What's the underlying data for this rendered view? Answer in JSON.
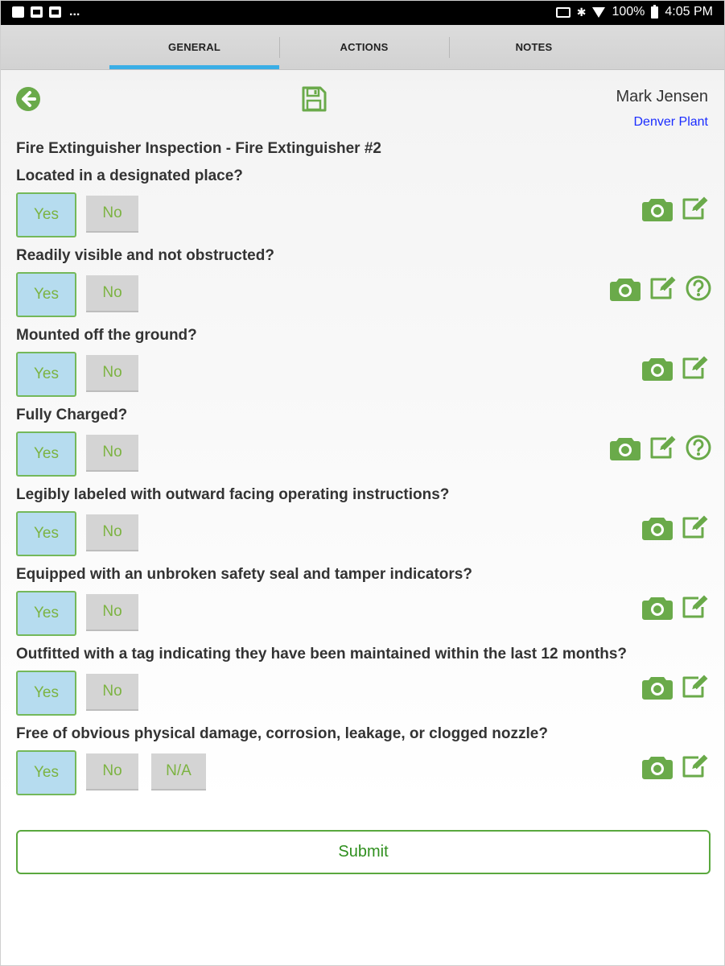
{
  "status_bar": {
    "dots": "...",
    "battery": "100%",
    "time": "4:05 PM"
  },
  "tabs": [
    {
      "label": "GENERAL",
      "active": true
    },
    {
      "label": "ACTIONS",
      "active": false
    },
    {
      "label": "NOTES",
      "active": false
    }
  ],
  "header": {
    "user_name": "Mark Jensen",
    "location": "Denver Plant"
  },
  "form_title": "Fire Extinguisher Inspection - Fire Extinguisher #2",
  "questions": [
    {
      "text": "Located in a designated place?",
      "options": [
        "Yes",
        "No"
      ],
      "selected": "Yes",
      "icons": [
        "camera-icon",
        "edit-icon"
      ]
    },
    {
      "text": "Readily visible and not obstructed?",
      "options": [
        "Yes",
        "No"
      ],
      "selected": "Yes",
      "icons": [
        "camera-icon",
        "edit-icon",
        "help-icon"
      ]
    },
    {
      "text": "Mounted off the ground?",
      "options": [
        "Yes",
        "No"
      ],
      "selected": "Yes",
      "icons": [
        "camera-icon",
        "edit-icon"
      ]
    },
    {
      "text": "Fully Charged?",
      "options": [
        "Yes",
        "No"
      ],
      "selected": "Yes",
      "icons": [
        "camera-icon",
        "edit-icon",
        "help-icon"
      ]
    },
    {
      "text": "Legibly labeled with outward facing operating instructions?",
      "options": [
        "Yes",
        "No"
      ],
      "selected": "Yes",
      "icons": [
        "camera-icon",
        "edit-icon"
      ]
    },
    {
      "text": "Equipped with an unbroken safety seal and tamper indicators?",
      "options": [
        "Yes",
        "No"
      ],
      "selected": "Yes",
      "icons": [
        "camera-icon",
        "edit-icon"
      ]
    },
    {
      "text": "Outfitted with a tag indicating they have been maintained within the last 12 months?",
      "options": [
        "Yes",
        "No"
      ],
      "selected": "Yes",
      "icons": [
        "camera-icon",
        "edit-icon"
      ]
    },
    {
      "text": "Free of obvious physical damage, corrosion, leakage, or clogged nozzle?",
      "options": [
        "Yes",
        "No",
        "N/A"
      ],
      "selected": "Yes",
      "icons": [
        "camera-icon",
        "edit-icon"
      ]
    }
  ],
  "submit_label": "Submit",
  "colors": {
    "accent_green": "#6aaa4a",
    "tab_indicator": "#3aaee6",
    "selected_bg": "#b6dcef",
    "link_blue": "#1a2cff"
  }
}
